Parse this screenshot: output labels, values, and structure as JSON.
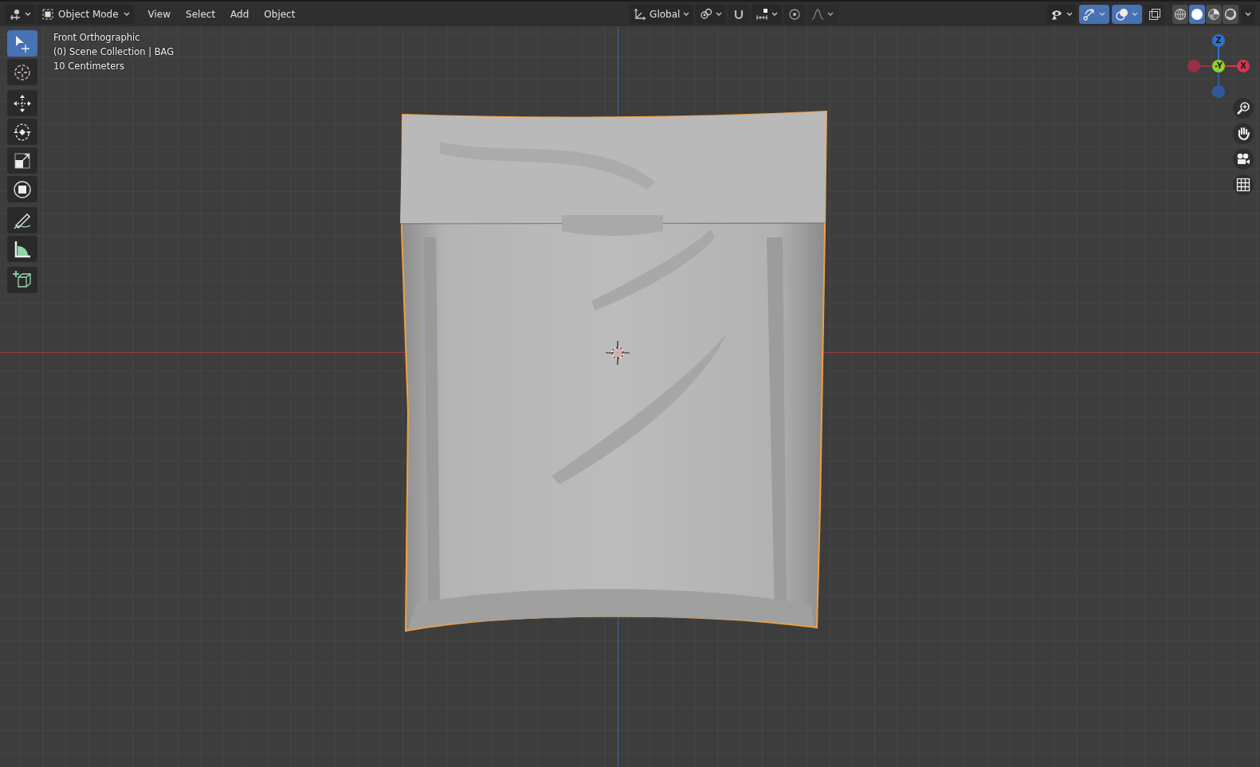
{
  "header": {
    "mode": {
      "label": "Object Mode"
    },
    "menus": [
      "View",
      "Select",
      "Add",
      "Object"
    ],
    "orientation": {
      "label": "Global"
    },
    "snap": {
      "on": false
    },
    "proportional": {
      "on": false
    },
    "visibility": {
      "on": false
    },
    "gizmos": {
      "on": true
    },
    "overlays": {
      "on": true
    },
    "xray": {
      "on": false
    },
    "shading": [
      {
        "kind": "wireframe",
        "selected": false
      },
      {
        "kind": "solid",
        "selected": true
      },
      {
        "kind": "material",
        "selected": false
      },
      {
        "kind": "rendered",
        "selected": false
      }
    ]
  },
  "toolbar": [
    {
      "kind": "select",
      "selected": true
    },
    {
      "kind": "cursor",
      "selected": false
    },
    {
      "kind": "move",
      "selected": false
    },
    {
      "kind": "rotate",
      "selected": false
    },
    {
      "kind": "scale",
      "selected": false
    },
    {
      "kind": "transform",
      "selected": false
    },
    {
      "kind": "annotate",
      "selected": false
    },
    {
      "kind": "measure",
      "selected": false
    },
    {
      "kind": "add-cube",
      "selected": false
    }
  ],
  "overlay_text": [
    "Front Orthographic",
    "(0) Scene Collection | BAG",
    "10 Centimeters"
  ],
  "gizmo": {
    "axes": [
      {
        "kind": "up",
        "label": "Z",
        "color": "#2f6fcf"
      },
      {
        "kind": "right",
        "label": "X",
        "color": "#d8344e"
      },
      {
        "kind": "center",
        "label": "-Y",
        "color": "#8ed127"
      },
      {
        "kind": "left",
        "color": "#9a3043"
      },
      {
        "kind": "down",
        "color": "#2c5a9c"
      }
    ]
  },
  "navigation": [
    {
      "kind": "zoom"
    },
    {
      "kind": "pan"
    },
    {
      "kind": "camera"
    },
    {
      "kind": "ortho"
    }
  ]
}
